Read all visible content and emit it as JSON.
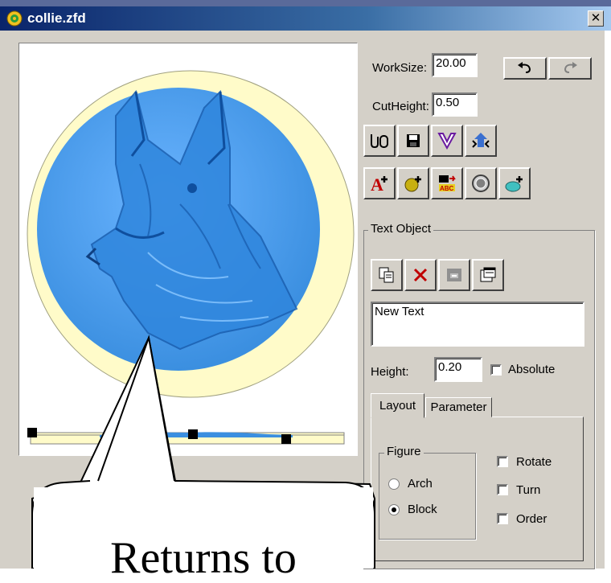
{
  "window": {
    "title": "collie.zfd",
    "close_label": "✕"
  },
  "colors": {
    "medallion_blue": "#3b8fe0",
    "ring_cream": "#fffbc9",
    "titlebar": "#0a246a"
  },
  "controls": {
    "worksize_label": "WorkSize:",
    "worksize_value": "20.00",
    "cutheight_label": "CutHeight:",
    "cutheight_value": "0.50"
  },
  "text_object": {
    "group_label": "Text Object",
    "text_value": "New Text",
    "height_label": "Height:",
    "height_value": "0.20",
    "absolute_label": "Absolute",
    "absolute_checked": false
  },
  "tabs": [
    {
      "label": "Layout",
      "active": true
    },
    {
      "label": "Parameter",
      "active": false
    }
  ],
  "layout_tab": {
    "figure_label": "Figure",
    "arch_label": "Arch",
    "block_label": "Block",
    "selected": "Block",
    "rotate_label": "Rotate",
    "turn_label": "Turn",
    "order_label": "Order"
  },
  "icons": {
    "undo": "undo-icon",
    "redo": "redo-icon",
    "open": "open-file-icon",
    "save": "save-icon",
    "vcarve": "v-carve-icon",
    "cut": "cut-path-icon",
    "add_text": "add-text-icon",
    "add_shape": "add-shape-icon",
    "text_to_path": "text-to-path-icon",
    "border": "border-icon",
    "add_relief": "add-relief-icon",
    "copy": "copy-icon",
    "delete": "delete-icon",
    "paste": "paste-icon",
    "properties": "properties-icon"
  },
  "callout": {
    "text": "Returns to"
  }
}
